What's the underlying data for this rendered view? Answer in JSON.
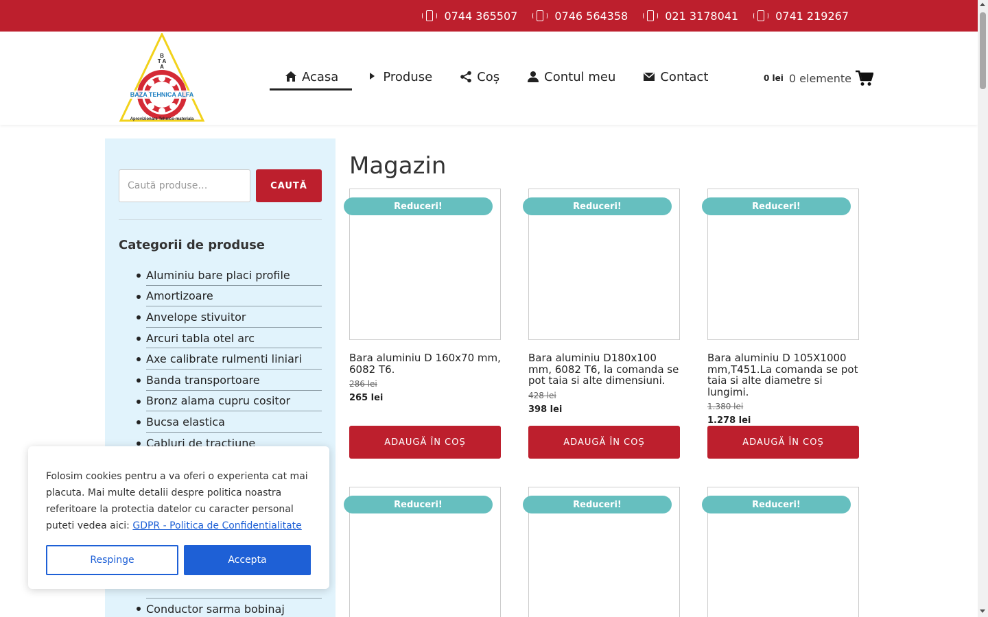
{
  "topbar": {
    "phones": [
      "0744 365507",
      "0746 564358",
      "021 3178041",
      "0741 219267"
    ]
  },
  "logo": {
    "letters_top": "B",
    "letters_mid": "T A",
    "letters_low": "A",
    "name": "BAZA TEHNICA ALFA",
    "tagline": "Aprovizionare Tehnico-materiala"
  },
  "nav": {
    "items": [
      {
        "label": "Acasa",
        "icon": "home-icon"
      },
      {
        "label": "Produse",
        "icon": "caret-right-icon"
      },
      {
        "label": "Coș",
        "icon": "share-icon"
      },
      {
        "label": "Contul meu",
        "icon": "user-icon"
      },
      {
        "label": "Contact",
        "icon": "envelope-icon"
      }
    ],
    "active": "Acasa"
  },
  "cart": {
    "total": "0 lei",
    "count": "0 elemente"
  },
  "sidebar": {
    "search_placeholder": "Caută produse…",
    "search_button": "CAUTĂ",
    "categories_title": "Categorii de produse",
    "categories": [
      "Aluminiu bare placi profile",
      "Amortizoare",
      "Anvelope stivuitor",
      "Arcuri tabla otel arc",
      "Axe calibrate rulmenti liniari",
      "Banda transportoare",
      "Bronz alama cupru cositor",
      "Bucsa elastica",
      "Cabluri de tractiune"
    ],
    "category_bottom": "Conductor sarma bobinaj"
  },
  "main": {
    "title": "Magazin",
    "badge": "Reduceri!",
    "add_to_cart": "ADAUGĂ ÎN COȘ",
    "products": [
      {
        "name": "Bara aluminiu D 160x70 mm, 6082 T6.",
        "old_price": "286 lei",
        "price": "265 lei"
      },
      {
        "name": "Bara aluminiu D180x100 mm, 6082 T6, la comanda se pot taia si alte dimensiuni.",
        "old_price": "428 lei",
        "price": "398 lei"
      },
      {
        "name": "Bara aluminiu D 105X1000 mm,T451.La comanda se pot taia si alte diametre si lungimi.",
        "old_price": "1.380 lei",
        "price": "1.278 lei"
      }
    ]
  },
  "cookie": {
    "text": "Folosim cookies pentru a va oferi o experienta cat mai placuta. Mai multe detalii despre politica noastra referitoare la protectia datelor cu caracter personal puteti vedea aici: ",
    "link": "GDPR - Politica de Confidentialitate",
    "reject": "Respinge",
    "accept": "Accepta"
  },
  "colors": {
    "brand_red": "#bd1f2d",
    "badge_teal": "#66bfbf",
    "sidebar_bg": "#e1f3fc",
    "cookie_blue": "#1e60d6"
  }
}
